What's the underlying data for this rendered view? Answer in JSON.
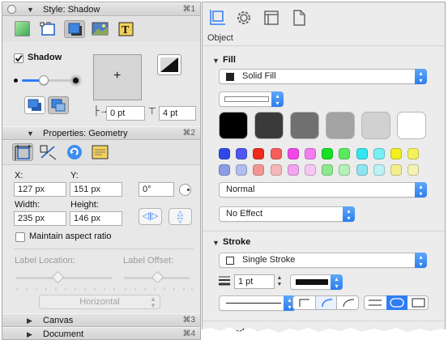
{
  "left_panel": {
    "style_header": {
      "label": "Style: Shadow",
      "shortcut": "⌘1"
    },
    "style_tools": [
      {
        "name": "fill-style-icon",
        "selected": false
      },
      {
        "name": "stroke-style-icon",
        "selected": false
      },
      {
        "name": "shadow-style-icon",
        "selected": true
      },
      {
        "name": "image-style-icon",
        "selected": false
      },
      {
        "name": "text-style-icon",
        "selected": false
      }
    ],
    "shadow": {
      "label": "Shadow",
      "checked": true,
      "x_offset": "0 pt",
      "y_offset": "4 pt",
      "blur_level": 0.45
    },
    "geometry_header": {
      "label": "Properties: Geometry",
      "shortcut": "⌘2"
    },
    "geometry": {
      "x_label": "X:",
      "x_value": "127 px",
      "y_label": "Y:",
      "y_value": "151 px",
      "rotation": "0°",
      "width_label": "Width:",
      "width_value": "235 px",
      "height_label": "Height:",
      "height_value": "146 px",
      "maintain_aspect": "Maintain aspect ratio",
      "label_location": "Label Location:",
      "label_offset": "Label Offset:",
      "orientation": "Horizontal"
    },
    "canvas_header": {
      "label": "Canvas",
      "shortcut": "⌘3"
    },
    "document_header": {
      "label": "Document",
      "shortcut": "⌘4"
    }
  },
  "right_panel": {
    "object_label": "Object",
    "fill": {
      "title": "Fill",
      "fill_type": "Solid Fill",
      "blend_mode": "Normal",
      "effect": "No Effect",
      "big_swatches": [
        "#000000",
        "#3a3a3a",
        "#707070",
        "#a3a3a3",
        "#d1d1d1",
        "#ffffff"
      ],
      "row1": [
        "#2f49e8",
        "#4f57ef",
        "#f02b1e",
        "#f45e5a",
        "#f246e9",
        "#f57cf0",
        "#16e122",
        "#5bea5e",
        "#33e6ef",
        "#76f0f3",
        "#f2ef1f",
        "#f4f25c"
      ],
      "row2": [
        "#8d9ce4",
        "#b4bdf0",
        "#f29694",
        "#f3b8b7",
        "#f2a5ef",
        "#f5c8f2",
        "#8ee88f",
        "#b5f0b6",
        "#8ee5ef",
        "#baf1f4",
        "#f2ef8c",
        "#f4f3b4"
      ]
    },
    "stroke": {
      "title": "Stroke",
      "stroke_type": "Single Stroke",
      "width": "1 pt"
    },
    "shadow_partial": "Shadow"
  }
}
